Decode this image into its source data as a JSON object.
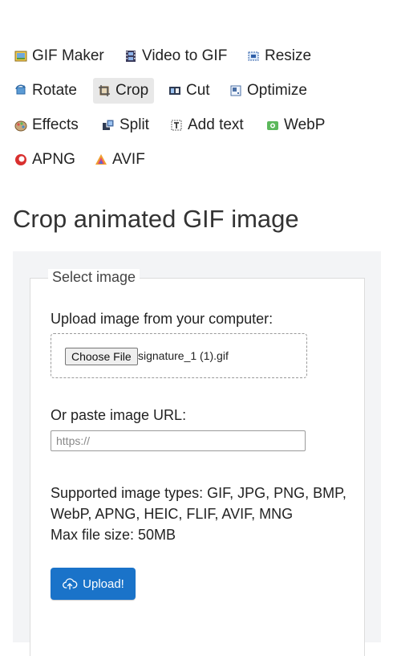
{
  "toolbar": {
    "items": [
      {
        "label": "GIF Maker",
        "icon": "gif-maker-icon"
      },
      {
        "label": "Video to GIF",
        "icon": "film-icon"
      },
      {
        "label": "Resize",
        "icon": "resize-icon"
      },
      {
        "label": "Rotate",
        "icon": "rotate-icon"
      },
      {
        "label": "Crop",
        "icon": "crop-icon",
        "active": true
      },
      {
        "label": "Cut",
        "icon": "cut-icon"
      },
      {
        "label": "Optimize",
        "icon": "optimize-icon"
      },
      {
        "label": "Effects",
        "icon": "effects-icon"
      },
      {
        "label": "Split",
        "icon": "split-icon"
      },
      {
        "label": "Add text",
        "icon": "add-text-icon"
      },
      {
        "label": "WebP",
        "icon": "webp-icon"
      },
      {
        "label": "APNG",
        "icon": "apng-icon"
      },
      {
        "label": "AVIF",
        "icon": "avif-icon"
      }
    ]
  },
  "page": {
    "title": "Crop animated GIF image"
  },
  "form": {
    "legend": "Select image",
    "upload_label": "Upload image from your computer:",
    "choose_file": "Choose File",
    "file_name": "signature_1 (1).gif",
    "url_label": "Or paste image URL:",
    "url_placeholder": "https://",
    "url_value": "",
    "types_line1": "Supported image types: GIF, JPG, PNG, BMP,",
    "types_line2": "WebP, APNG, HEIC, FLIF, AVIF, MNG",
    "max_size": "Max file size: 50MB",
    "upload_button": "Upload!"
  },
  "colors": {
    "accent": "#1a73c9",
    "panel_bg": "#f3f4f6",
    "active_tab_bg": "#e8e8e8"
  }
}
